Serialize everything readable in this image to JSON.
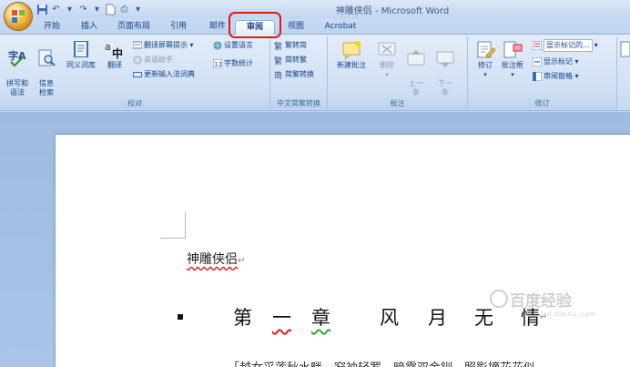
{
  "window": {
    "title": "神雕侠侣 - Microsoft Word"
  },
  "qat": {
    "icons": [
      "save-icon",
      "undo-icon",
      "redo-icon",
      "new-icon",
      "print-icon",
      "customize-icon"
    ]
  },
  "tabs": [
    {
      "label": "开始"
    },
    {
      "label": "插入"
    },
    {
      "label": "页面布局"
    },
    {
      "label": "引用"
    },
    {
      "label": "邮件"
    },
    {
      "label": "审阅"
    },
    {
      "label": "视图"
    },
    {
      "label": "Acrobat"
    }
  ],
  "active_tab": "审阅",
  "ribbon": {
    "proofing": {
      "label": "校对",
      "pinyin": "拼写和\n语法",
      "research": "信息\n检索",
      "thesaurus": "同义词库",
      "translate": "翻译",
      "translate_tip": "翻译屏幕提示 ▾",
      "english_assistant": "英语助手",
      "update_ime": "更新输入法词典",
      "set_language": "设置语言",
      "word_count": "字数统计"
    },
    "chinese_conversion": {
      "label": "中文简繁转换",
      "to_simplified": "繁转简",
      "to_traditional": "简转繁",
      "convert": "简繁转换"
    },
    "comments": {
      "label": "批注",
      "new_comment": "新建批注",
      "delete": "删除",
      "previous": "上一\n条",
      "next": "下一\n条"
    },
    "tracking": {
      "label": "修订",
      "track_changes": "修订",
      "balloons": "批注框",
      "display_markup": "显示标记的...",
      "show_markup": "显示标记 ▾",
      "reviewing_pane": "审阅窗格 ▾"
    }
  },
  "document": {
    "title": "神雕侠侣",
    "chapter": [
      "第",
      "一",
      "章",
      "风",
      "月",
      "无",
      "情"
    ],
    "next_line": "「越女采莲秋水畔，窄袖轻罗，暗露双金钏。照影摘花花似"
  },
  "watermark": {
    "main": "百度经验",
    "sub": "jingyan.baidu.com"
  }
}
